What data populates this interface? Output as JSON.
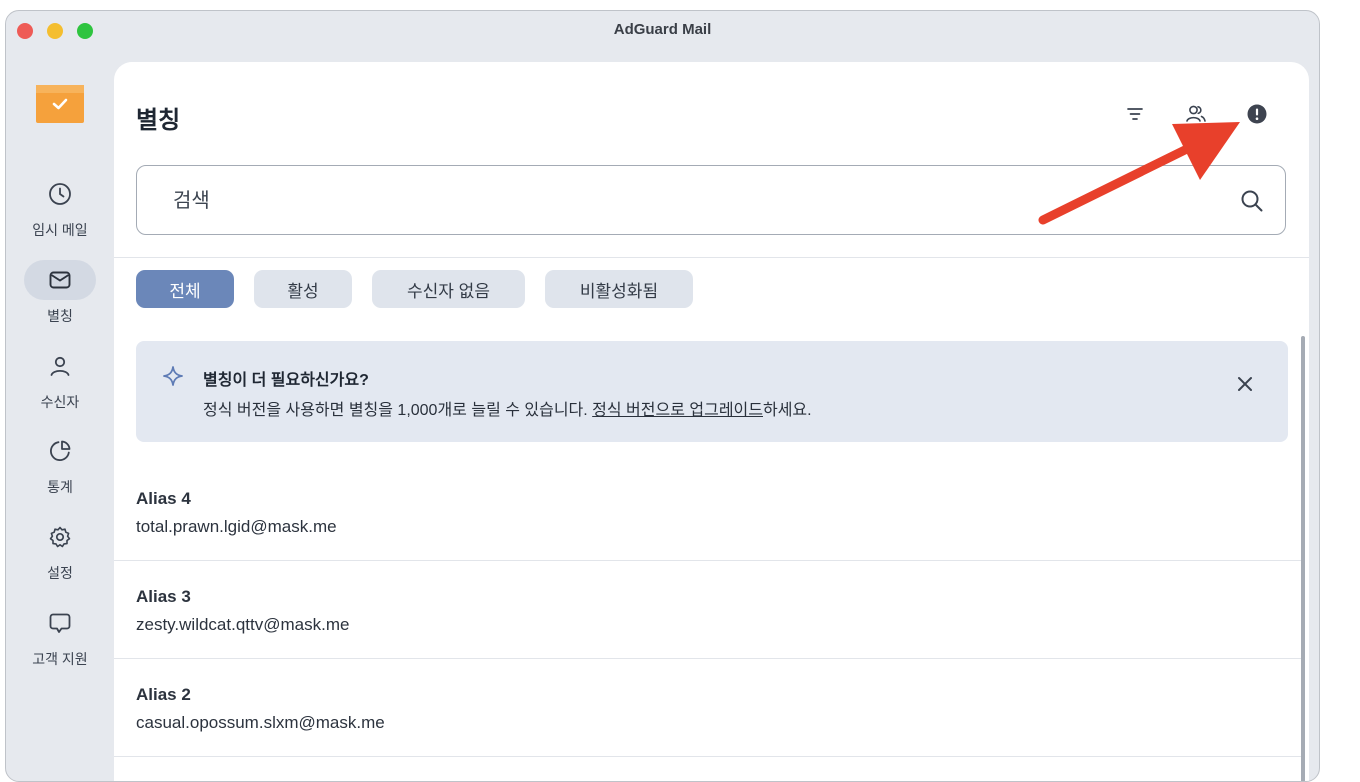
{
  "window": {
    "title": "AdGuard Mail"
  },
  "sidebar": {
    "items": [
      {
        "label": "임시 메일",
        "icon": "clock-icon"
      },
      {
        "label": "별칭",
        "icon": "mail-icon",
        "active": true
      },
      {
        "label": "수신자",
        "icon": "person-icon"
      },
      {
        "label": "통계",
        "icon": "pie-chart-icon"
      },
      {
        "label": "설정",
        "icon": "gear-icon"
      },
      {
        "label": "고객 지원",
        "icon": "chat-icon"
      }
    ]
  },
  "header": {
    "title": "별칭",
    "icons": [
      "filter-icon",
      "users-icon",
      "info-icon"
    ]
  },
  "search": {
    "placeholder": "검색"
  },
  "filters": [
    "전체",
    "활성",
    "수신자 없음",
    "비활성화됨"
  ],
  "banner": {
    "title": "별칭이 더 필요하신가요?",
    "text_before": "정식 버전을 사용하면 별칭을 1,000개로 늘릴 수 있습니다. ",
    "link": "정식 버전으로 업그레이드",
    "text_after": "하세요."
  },
  "aliases": [
    {
      "name": "Alias 4",
      "email": "total.prawn.lgid@mask.me"
    },
    {
      "name": "Alias 3",
      "email": "zesty.wildcat.qttv@mask.me"
    },
    {
      "name": "Alias 2",
      "email": "casual.opossum.slxm@mask.me"
    }
  ],
  "colors": {
    "accent": "#6b87b9",
    "chip_bg": "#dfe4ec",
    "banner_bg": "#e3e8f1",
    "sidebar_bg": "#e6e9ee",
    "logo": "#f5a13c",
    "annotation_arrow": "#e8402b"
  }
}
